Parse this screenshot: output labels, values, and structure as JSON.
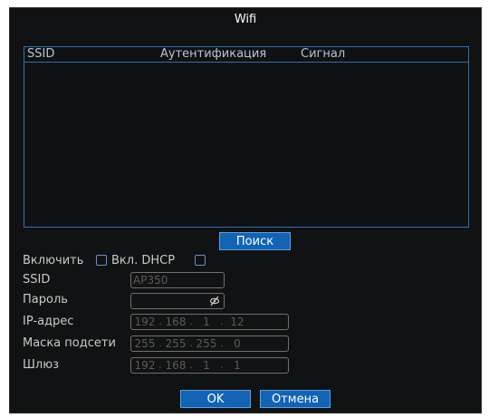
{
  "title": "Wifi",
  "list": {
    "columns": [
      "SSID",
      "Аутентификация",
      "Сигнал"
    ]
  },
  "search_label": "Поиск",
  "enable_label": "Включить",
  "dhcp_label": "Вкл. DHCP",
  "fields": {
    "ssid_label": "SSID",
    "ssid_value": "AP350",
    "password_label": "Пароль",
    "ip_label": "IP-адрес",
    "ip_value": [
      "192",
      "168",
      "1",
      "12"
    ],
    "mask_label": "Маска подсети",
    "mask_value": [
      "255",
      "255",
      "255",
      "0"
    ],
    "gateway_label": "Шлюз",
    "gateway_value": [
      "192",
      "168",
      "1",
      "1"
    ]
  },
  "ok_label": "OK",
  "cancel_label": "Отмена",
  "colors": {
    "accent": "#1263b4",
    "border_blue": "#2f6fb3",
    "background": "#111213"
  }
}
